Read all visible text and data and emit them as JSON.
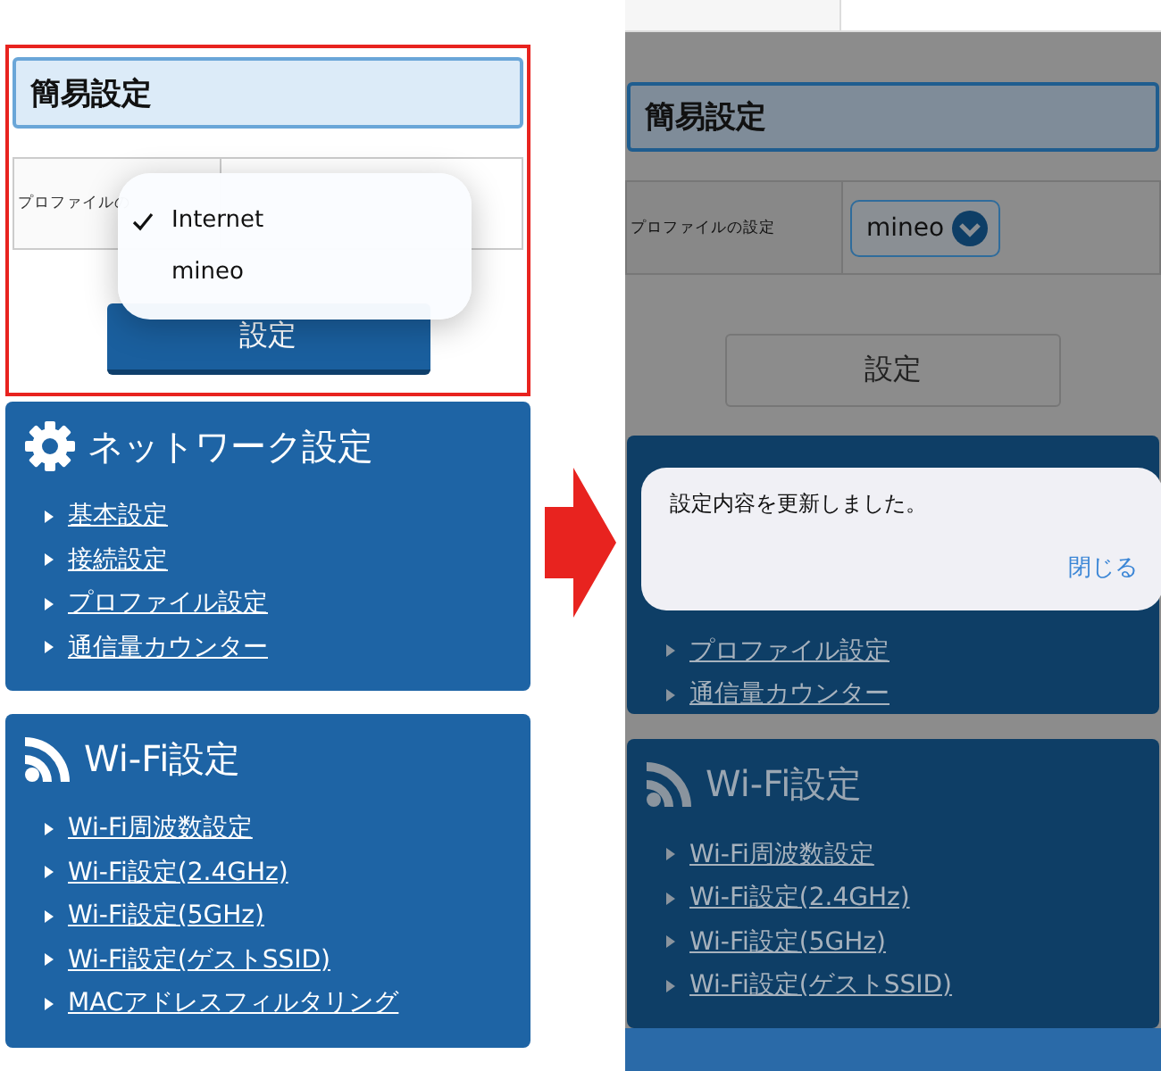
{
  "left": {
    "highlighted": true,
    "section_title": "簡易設定",
    "profile_label": "プロファイルの",
    "menu": [
      {
        "label": "Internet",
        "selected": true
      },
      {
        "label": "mineo",
        "selected": false
      }
    ],
    "submit": "設定",
    "cards": [
      {
        "kind": "network",
        "title": "ネットワーク設定",
        "links": [
          "基本設定",
          "接続設定",
          "プロファイル設定",
          "通信量カウンター"
        ]
      },
      {
        "kind": "wifi",
        "title": "Wi-Fi設定",
        "links": [
          "Wi-Fi周波数設定",
          "Wi-Fi設定(2.4GHz)",
          "Wi-Fi設定(5GHz)",
          "Wi-Fi設定(ゲストSSID)",
          "MACアドレスフィルタリング"
        ]
      }
    ]
  },
  "right": {
    "section_title": "簡易設定",
    "profile_label": "プロファイルの設定",
    "profile_value": "mineo",
    "submit": "設定",
    "cards": [
      {
        "kind": "network",
        "links": [
          "プロファイル設定",
          "通信量カウンター"
        ]
      },
      {
        "kind": "wifi",
        "title": "Wi-Fi設定",
        "links": [
          "Wi-Fi周波数設定",
          "Wi-Fi設定(2.4GHz)",
          "Wi-Fi設定(5GHz)",
          "Wi-Fi設定(ゲストSSID)"
        ]
      }
    ],
    "dialog": {
      "message": "設定内容を更新しました。",
      "close": "閉じる"
    }
  }
}
